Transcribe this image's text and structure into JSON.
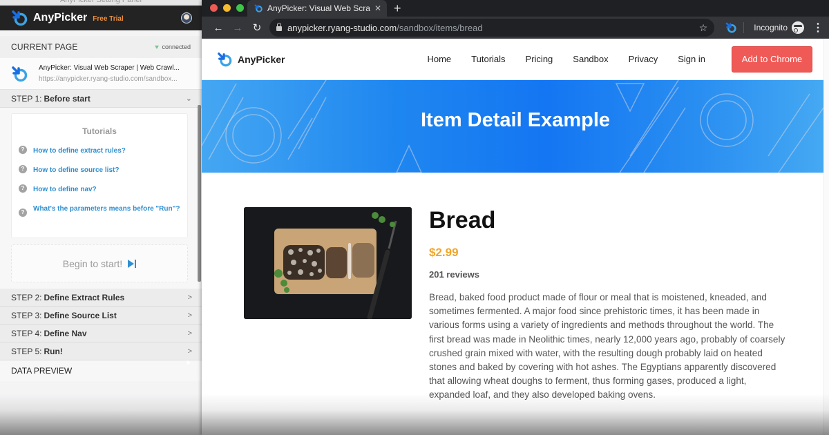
{
  "panel": {
    "window_title": "AnyPicker Setting Panel",
    "brand": "AnyPicker",
    "trial_badge": "Free Trial",
    "current_page_label": "CURRENT PAGE",
    "connection_status": "connected",
    "current_page": {
      "title": "AnyPicker: Visual Web Scraper | Web Crawl...",
      "url": "https://anypicker.ryang-studio.com/sandbox..."
    },
    "steps": [
      {
        "prefix": "STEP 1:",
        "name": "Before start",
        "expanded": true
      },
      {
        "prefix": "STEP 2:",
        "name": "Define Extract Rules",
        "expanded": false
      },
      {
        "prefix": "STEP 3:",
        "name": "Define Source List",
        "expanded": false
      },
      {
        "prefix": "STEP 4:",
        "name": "Define Nav",
        "expanded": false
      },
      {
        "prefix": "STEP 5:",
        "name": "Run!",
        "expanded": false
      }
    ],
    "tutorials": {
      "title": "Tutorials",
      "items": [
        "How to define extract rules?",
        "How to define source list?",
        "How to define nav?",
        "What's the parameters means before \"Run\"?"
      ]
    },
    "begin_label": "Begin to start!",
    "data_preview_label": "DATA PREVIEW"
  },
  "browser": {
    "tab_title": "AnyPicker: Visual Web Scraper",
    "url_host": "anypicker.ryang-studio.com",
    "url_path": "/sandbox/items/bread",
    "incognito_label": "Incognito"
  },
  "site": {
    "brand": "AnyPicker",
    "nav": [
      "Home",
      "Tutorials",
      "Pricing",
      "Sandbox",
      "Privacy",
      "Sign in"
    ],
    "cta": "Add to Chrome",
    "hero_title": "Item Detail Example",
    "product": {
      "name": "Bread",
      "price": "$2.99",
      "reviews": "201 reviews",
      "description": "Bread, baked food product made of flour or meal that is moistened, kneaded, and sometimes fermented. A major food since prehistoric times, it has been made in various forms using a variety of ingredients and methods throughout the world. The first bread was made in Neolithic times, nearly 12,000 years ago, probably of coarsely crushed grain mixed with water, with the resulting dough probably laid on heated stones and baked by covering with hot ashes. The Egyptians apparently discovered that allowing wheat doughs to ferment, thus forming gases, produced a light, expanded loaf, and they also developed baking ovens."
    }
  },
  "colors": {
    "accent_blue": "#2f8fd0",
    "cta_red": "#ef5a57",
    "price_orange": "#f0a62a",
    "trial_orange": "#f0903a"
  }
}
